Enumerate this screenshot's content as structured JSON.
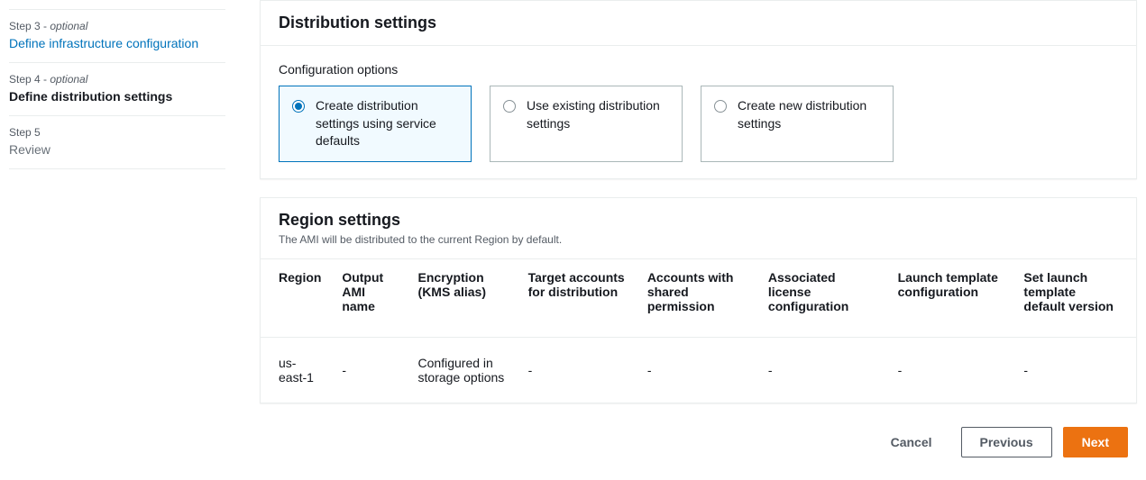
{
  "sidebar": {
    "steps": [
      {
        "label": "Step 3 - ",
        "optional": "optional",
        "title": "Define infrastructure configuration",
        "state": "link"
      },
      {
        "label": "Step 4 - ",
        "optional": "optional",
        "title": "Define distribution settings",
        "state": "active"
      },
      {
        "label": "Step 5",
        "optional": "",
        "title": "Review",
        "state": "muted"
      }
    ]
  },
  "distribution": {
    "heading": "Distribution settings",
    "config_label": "Configuration options",
    "options": [
      "Create distribution settings using service defaults",
      "Use existing distribution settings",
      "Create new distribution settings"
    ],
    "selected": 0
  },
  "region": {
    "heading": "Region settings",
    "subtitle": "The AMI will be distributed to the current Region by default.",
    "columns": [
      "Region",
      "Output AMI name",
      "Encryption (KMS alias)",
      "Target accounts for distribution",
      "Accounts with shared permission",
      "Associated license configuration",
      "Launch template configuration",
      "Set launch template default version"
    ],
    "rows": [
      {
        "cells": [
          "us-east-1",
          "-",
          "Configured in storage options",
          "-",
          "-",
          "-",
          "-",
          "-"
        ]
      }
    ]
  },
  "footer": {
    "cancel": "Cancel",
    "previous": "Previous",
    "next": "Next"
  }
}
